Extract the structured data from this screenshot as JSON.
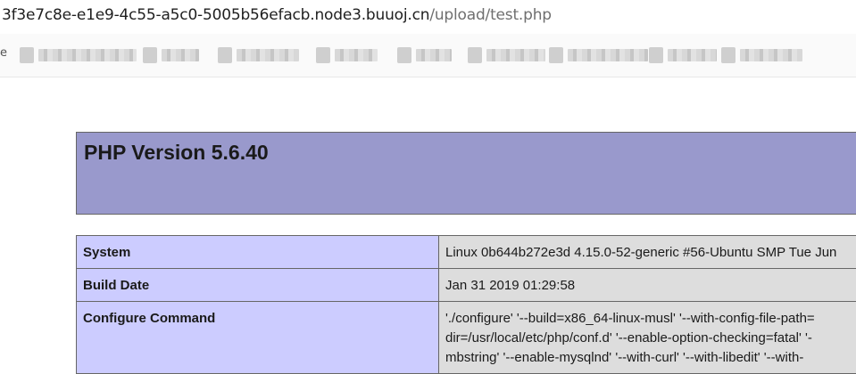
{
  "browser": {
    "url_host": "3f3e7c8e-e1e9-4c55-a5c0-5005b56efacb.node3.buuoj.cn",
    "url_path": "/upload/test.php",
    "bookmarks_edge_glyph": "e",
    "bookmark_count": 9
  },
  "phpinfo": {
    "title": "PHP Version 5.6.40",
    "colors": {
      "header_bg": "#9999cc",
      "key_bg": "#ccccff",
      "value_bg": "#dddddd",
      "border": "#666666"
    },
    "rows": [
      {
        "key": "System",
        "value": "Linux 0b644b272e3d 4.15.0-52-generic #56-Ubuntu SMP Tue Jun"
      },
      {
        "key": "Build Date",
        "value": "Jan 31 2019 01:29:58"
      },
      {
        "key": "Configure Command",
        "value": "'./configure' '--build=x86_64-linux-musl' '--with-config-file-path=\ndir=/usr/local/etc/php/conf.d' '--enable-option-checking=fatal' '-\nmbstring' '--enable-mysqlnd' '--with-curl' '--with-libedit' '--with-\n"
      }
    ]
  }
}
